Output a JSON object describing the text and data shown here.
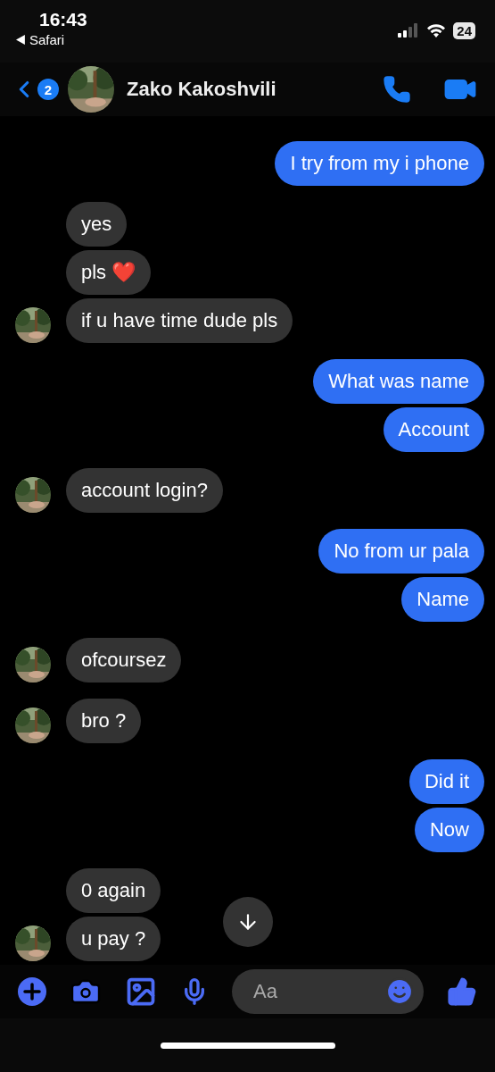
{
  "status_bar": {
    "time": "16:43",
    "back_app": "Safari",
    "battery": "24"
  },
  "header": {
    "unread": "2",
    "name": "Zako Kakoshvili"
  },
  "groups": [
    {
      "kind": "sent",
      "messages": [
        "I try from my i phone"
      ]
    },
    {
      "kind": "received",
      "messages": [
        "yes",
        "pls ❤️",
        "if u have time dude pls"
      ]
    },
    {
      "kind": "sent",
      "messages": [
        "What was name",
        "Account"
      ]
    },
    {
      "kind": "received",
      "messages": [
        "account login?"
      ]
    },
    {
      "kind": "sent",
      "messages": [
        "No from ur pala",
        "Name"
      ]
    },
    {
      "kind": "received",
      "messages": [
        "ofcoursez"
      ]
    },
    {
      "kind": "received",
      "messages": [
        "bro ?"
      ]
    },
    {
      "kind": "sent",
      "messages": [
        "Did it",
        "Now"
      ]
    },
    {
      "kind": "received",
      "messages": [
        "0 again",
        "u pay ?"
      ]
    }
  ],
  "composer": {
    "placeholder": "Aa"
  }
}
